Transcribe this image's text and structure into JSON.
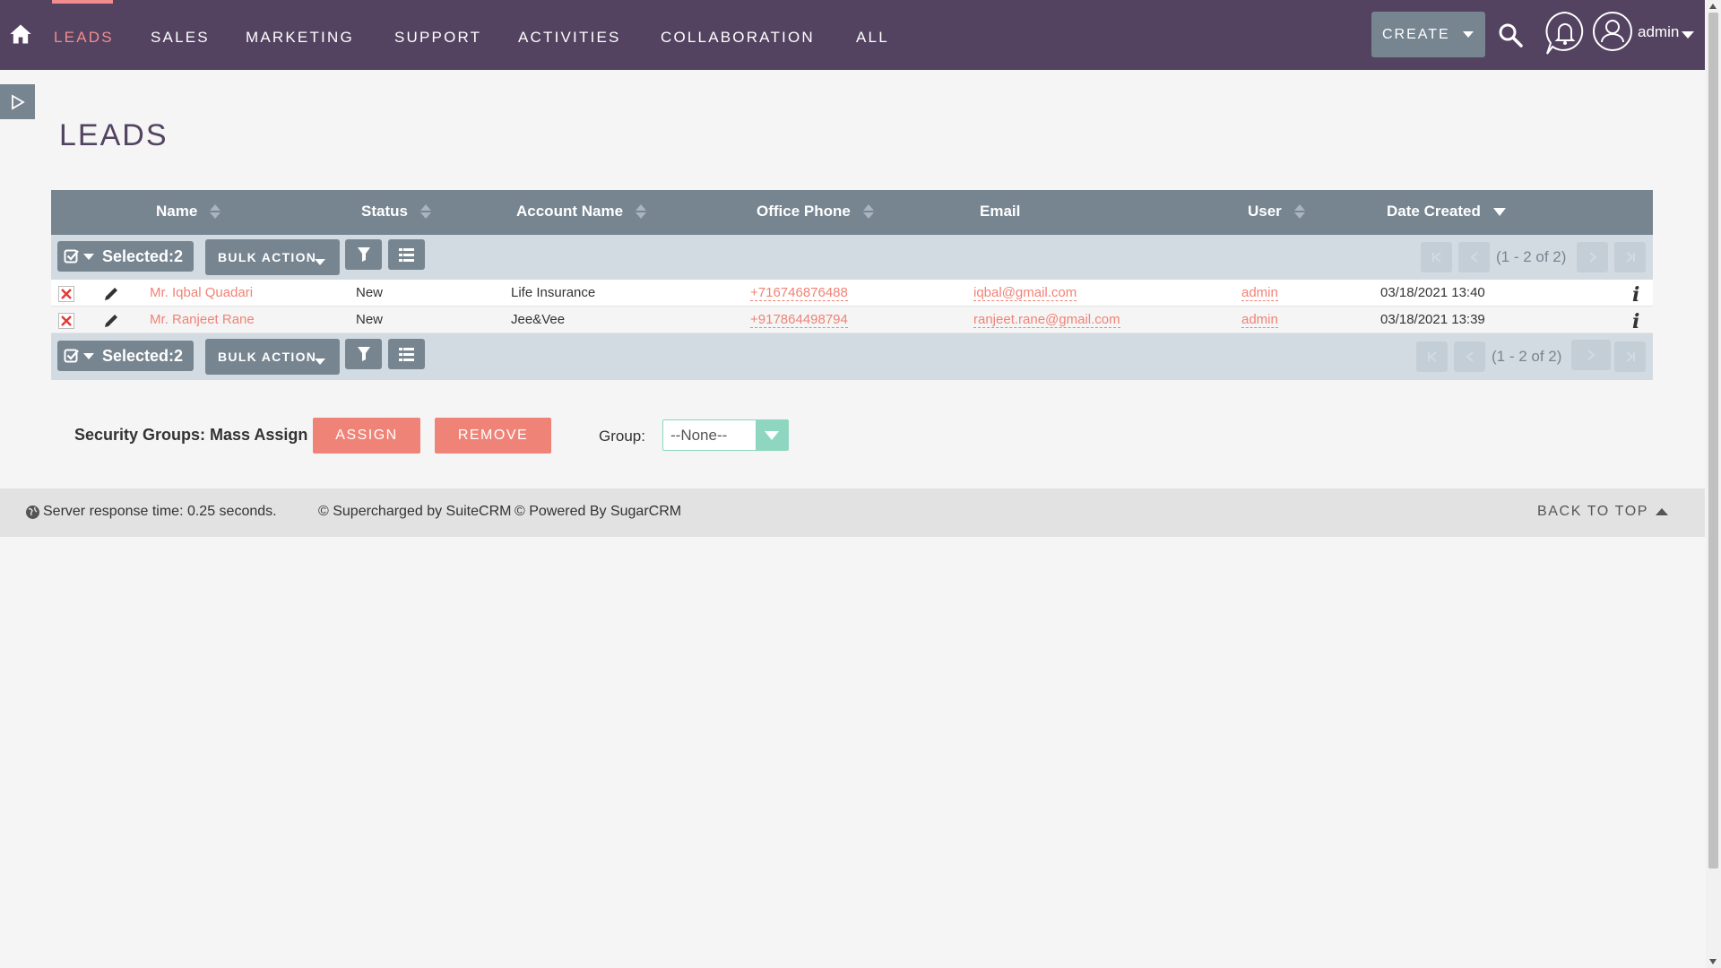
{
  "nav": {
    "items": [
      {
        "label": "LEADS",
        "active": true
      },
      {
        "label": "SALES"
      },
      {
        "label": "MARKETING"
      },
      {
        "label": "SUPPORT"
      },
      {
        "label": "ACTIVITIES"
      },
      {
        "label": "COLLABORATION"
      },
      {
        "label": "ALL"
      }
    ],
    "create_label": "CREATE",
    "user_label": "admin"
  },
  "page": {
    "title": "LEADS"
  },
  "table": {
    "columns": [
      "Name",
      "Status",
      "Account Name",
      "Office Phone",
      "Email",
      "User",
      "Date Created"
    ],
    "selected_label": "Selected:2",
    "bulk_action_label": "BULK ACTION",
    "pagination_top": "(1 - 2 of 2)",
    "pagination_bottom": "(1 - 2 of 2)",
    "rows": [
      {
        "name": "Mr. Iqbal Quadari",
        "status": "New",
        "account": "Life Insurance",
        "phone": "+716746876488",
        "email": "iqbal@gmail.com",
        "user": "admin",
        "date": "03/18/2021 13:40"
      },
      {
        "name": "Mr. Ranjeet Rane",
        "status": "New",
        "account": "Jee&Vee",
        "phone": "+917864498794",
        "email": "ranjeet.rane@gmail.com",
        "user": "admin",
        "date": "03/18/2021 13:39"
      }
    ]
  },
  "security": {
    "label": "Security Groups: Mass Assign",
    "assign_label": "ASSIGN",
    "remove_label": "REMOVE",
    "group_label": "Group:",
    "group_value": "--None--"
  },
  "footer": {
    "response_time": "Server response time: 0.25 seconds.",
    "supercharged": "© Supercharged by SuiteCRM",
    "powered": "© Powered By SugarCRM",
    "back_to_top": "BACK TO TOP"
  },
  "colors": {
    "nav_bg": "#534361",
    "accent": "#f28d8d",
    "button_gray": "#778591",
    "select_accent": "#8fd6c1"
  }
}
